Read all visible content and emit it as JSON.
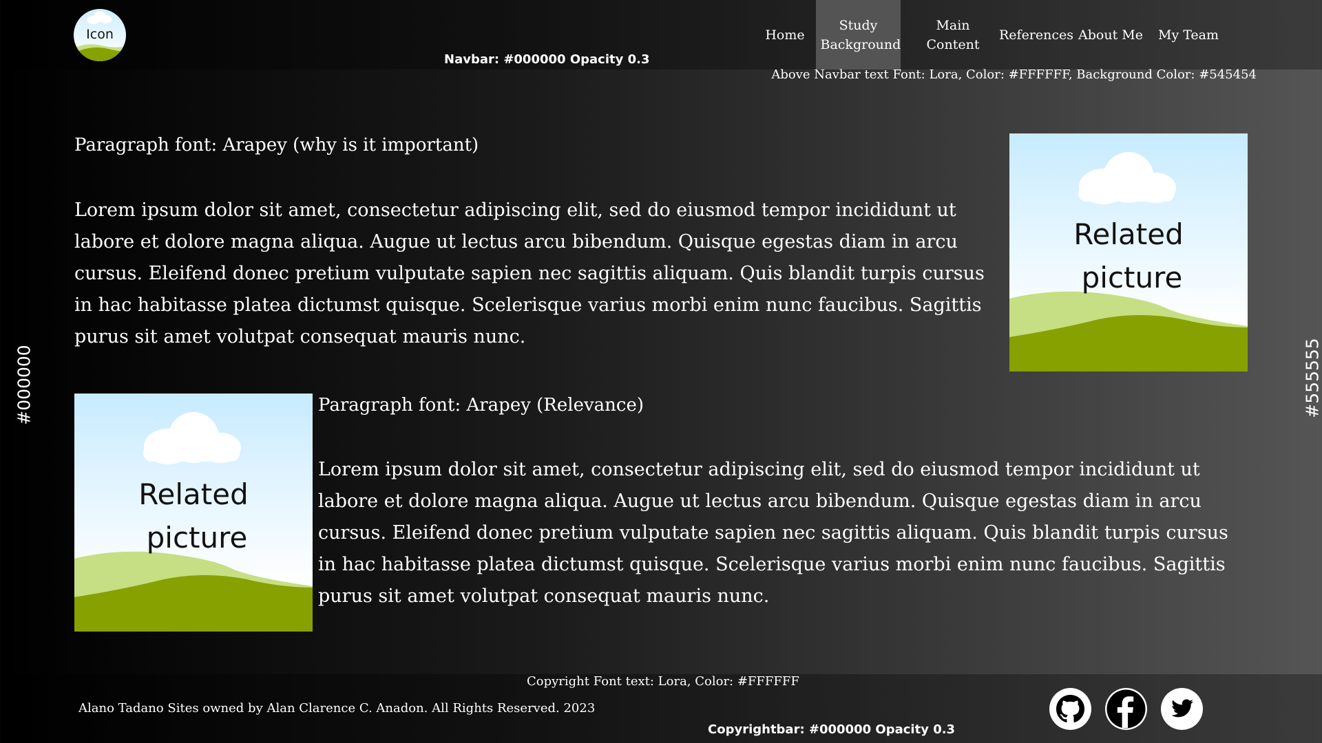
{
  "navbar": {
    "logo_text": "Icon",
    "note": "Navbar: #000000 Opacity 0.3",
    "items": [
      {
        "label": "Home"
      },
      {
        "label": "Study Background"
      },
      {
        "label": "Main Content"
      },
      {
        "label": "References"
      },
      {
        "label": "About Me"
      },
      {
        "label": "My Team"
      }
    ],
    "active_item": "Study Background",
    "above_note": "Above Navbar text Font: Lora, Color: #FFFFFF, Background Color: #545454"
  },
  "section1": {
    "title": "Paragraph font: Arapey (why is it important)",
    "paragraph": "Lorem ipsum dolor sit amet, consectetur adipiscing elit, sed do eiusmod tempor incididunt ut labore et dolore magna aliqua. Augue ut lectus arcu bibendum. Quisque egestas diam in arcu cursus. Eleifend donec pretium vulputate sapien nec sagittis aliquam. Quis blandit turpis cursus in hac habitasse platea dictumst quisque. Scelerisque varius morbi enim nunc faucibus. Sagittis purus sit amet volutpat consequat mauris nunc.",
    "picture_line1": "Related",
    "picture_line2": "picture"
  },
  "section2": {
    "title": "Paragraph font: Arapey (Relevance)",
    "paragraph": "Lorem ipsum dolor sit amet, consectetur adipiscing elit, sed do eiusmod tempor incididunt ut labore et dolore magna aliqua. Augue ut lectus arcu bibendum. Quisque egestas diam in arcu cursus. Eleifend donec pretium vulputate sapien nec sagittis aliquam. Quis blandit turpis cursus in hac habitasse platea dictumst quisque. Scelerisque varius morbi enim nunc faucibus. Sagittis purus sit amet volutpat consequat mauris nunc.",
    "picture_line1": "Related",
    "picture_line2": "picture"
  },
  "side_labels": {
    "left": "#000000",
    "right": "#555555"
  },
  "footer": {
    "copyright_note": "Copyright Font text: Lora, Color: #FFFFFF",
    "owner_text": "Alano Tadano Sites owned by Alan Clarence C. Anadon. All Rights Reserved. 2023",
    "copybar_note": "Copyrightbar: #000000 Opacity 0.3",
    "social_icons": [
      "github-icon",
      "facebook-icon",
      "twitter-icon"
    ]
  },
  "colors": {
    "navbar_active_bg": "#545454",
    "text": "#FFFFFF",
    "hill_dark": "#86a100",
    "hill_light": "#c6df84"
  }
}
